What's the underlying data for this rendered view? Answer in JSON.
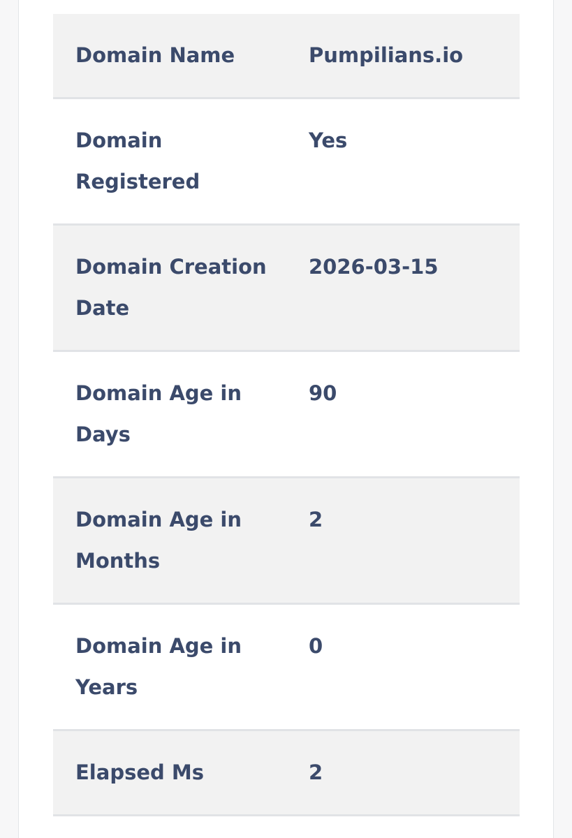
{
  "rows": [
    {
      "label": "Domain Name",
      "value": "Pumpilians.io"
    },
    {
      "label": "Domain Registered",
      "value": "Yes"
    },
    {
      "label": "Domain Creation Date",
      "value": "2026-03-15"
    },
    {
      "label": "Domain Age in Days",
      "value": "90"
    },
    {
      "label": "Domain Age in Months",
      "value": "2"
    },
    {
      "label": "Domain Age in Years",
      "value": "0"
    },
    {
      "label": "Elapsed Ms",
      "value": "2"
    }
  ],
  "colors": {
    "text": "#3b4a6b",
    "row_shade": "#f2f2f2",
    "row_border": "#e1e3e6"
  }
}
